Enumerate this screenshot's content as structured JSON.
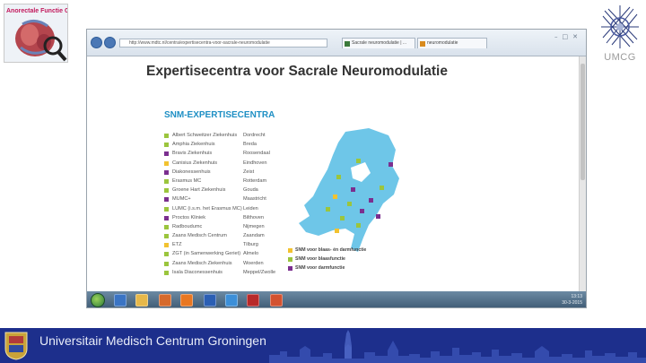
{
  "slide": {
    "umcg_logo_text": "UMCG",
    "left_logo_text": "Anorectale Functie Centrum",
    "footer_text": "Universitair Medisch Centrum Groningen"
  },
  "browser": {
    "url": "http://www.mdtc.nl/centra/expertisecentra-voor-sacrale-neuromodulatie",
    "tabs": [
      {
        "label": "Sacrale neuromodulatie | ..."
      },
      {
        "label": "neuromodulatie"
      }
    ]
  },
  "page": {
    "title": "Expertisecentra voor Sacrale Neuromodulatie",
    "section_title": "SNM-EXPERTISECENTRA"
  },
  "centers": [
    {
      "name": "Albert Schweitzer Ziekenhuis",
      "city": "Dordrecht",
      "color": "#9bc53d"
    },
    {
      "name": "Amphia Ziekenhuis",
      "city": "Breda",
      "color": "#9bc53d"
    },
    {
      "name": "Bravis Ziekenhuis",
      "city": "Roosendaal",
      "color": "#7b2f8f"
    },
    {
      "name": "Canisius Ziekenhuis",
      "city": "Eindhoven",
      "color": "#f2c230"
    },
    {
      "name": "Diakonessenhuis",
      "city": "Zeist",
      "color": "#7b2f8f"
    },
    {
      "name": "Erasmus MC",
      "city": "Rotterdam",
      "color": "#9bc53d"
    },
    {
      "name": "Groene Hart Ziekenhuis",
      "city": "Gouda",
      "color": "#9bc53d"
    },
    {
      "name": "MUMC+",
      "city": "Maastricht",
      "color": "#7b2f8f"
    },
    {
      "name": "LUMC (i.s.m. het Erasmus MC)",
      "city": "Leiden",
      "color": "#9bc53d"
    },
    {
      "name": "Proctos Kliniek",
      "city": "Bilthoven",
      "color": "#7b2f8f"
    },
    {
      "name": "Radboudumc",
      "city": "Nijmegen",
      "color": "#9bc53d"
    },
    {
      "name": "Zaans Medisch Centrum",
      "city": "Zaandam",
      "color": "#9bc53d"
    },
    {
      "name": "ETZ",
      "city": "Tilburg",
      "color": "#f2c230"
    },
    {
      "name": "ZGT (in Samenwerking Geriet)",
      "city": "Almelo",
      "color": "#9bc53d"
    },
    {
      "name": "Zaans Medisch Ziekenhuis",
      "city": "Woerden",
      "color": "#9bc53d"
    },
    {
      "name": "Isala Diaconessenhuis",
      "city": "Meppel/Zwolle",
      "color": "#9bc53d"
    }
  ],
  "legend": [
    {
      "label": "SNM voor blaas- én darmfunctie",
      "color": "#f2c230"
    },
    {
      "label": "SNM voor blaasfunctie",
      "color": "#9bc53d"
    },
    {
      "label": "SNM voor darmfunctie",
      "color": "#7b2f8f"
    }
  ],
  "map_markers": [
    {
      "color": "#9bc53d"
    },
    {
      "color": "#9bc53d"
    },
    {
      "color": "#7b2f8f"
    },
    {
      "color": "#f2c230"
    },
    {
      "color": "#7b2f8f"
    },
    {
      "color": "#9bc53d"
    },
    {
      "color": "#7b2f8f"
    },
    {
      "color": "#9bc53d"
    },
    {
      "color": "#9bc53d"
    },
    {
      "color": "#7b2f8f"
    },
    {
      "color": "#9bc53d"
    },
    {
      "color": "#f2c230"
    },
    {
      "color": "#9bc53d"
    },
    {
      "color": "#7b2f8f"
    }
  ],
  "taskbar": {
    "time": "13:13",
    "date": "30-3-2015"
  },
  "colors": {
    "footer_bg": "#1d2f8c",
    "section_title": "#1e8fc4",
    "map_fill": "#6ec6e8"
  }
}
